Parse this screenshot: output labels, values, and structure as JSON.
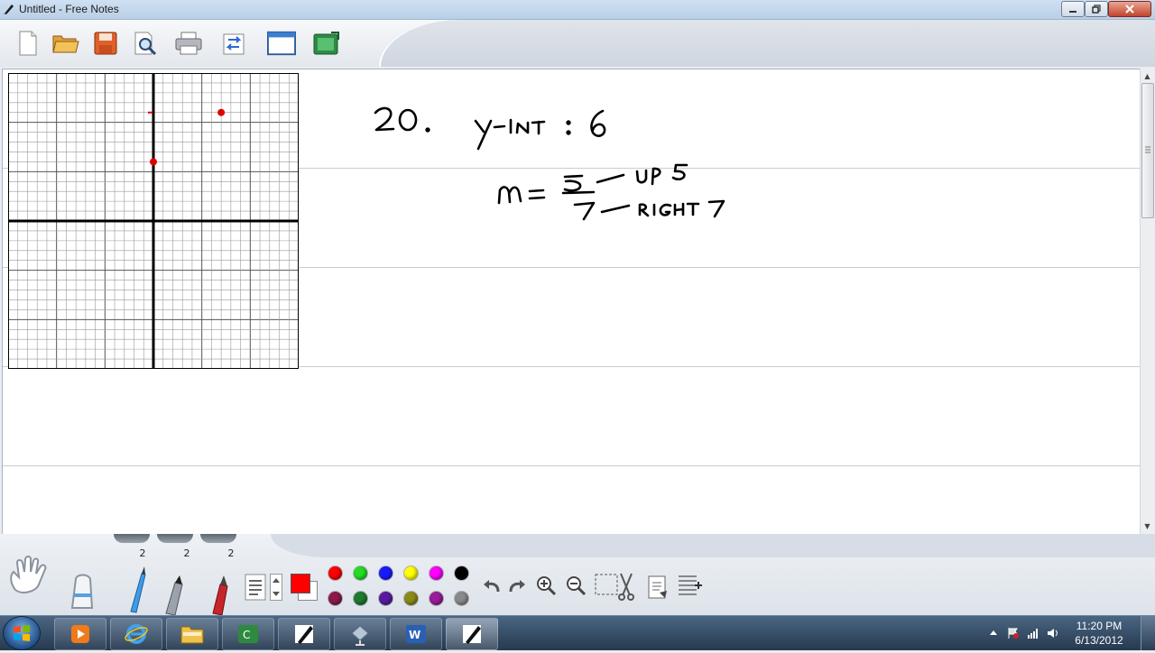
{
  "window": {
    "title": "Untitled - Free Notes"
  },
  "toolbar": {
    "buttons": [
      {
        "name": "new-document-icon"
      },
      {
        "name": "open-folder-icon"
      },
      {
        "name": "save-icon"
      },
      {
        "name": "print-preview-icon"
      },
      {
        "name": "print-icon"
      },
      {
        "name": "import-export-icon"
      },
      {
        "name": "window-view-icon"
      },
      {
        "name": "screen-capture-icon"
      }
    ]
  },
  "notes": {
    "problem_number": "20.",
    "y_intercept_text": "y-int : 6",
    "slope_label": "m=",
    "rise_text": "5 — UP 5",
    "run_text": "7 — RIGHT 7",
    "graph_points": [
      {
        "x": 0,
        "y": 6
      },
      {
        "x": 7,
        "y": 11
      }
    ]
  },
  "pen_widths": [
    "2",
    "2",
    "2"
  ],
  "tools": {
    "selected_color": "#ff0000",
    "palette_row1": [
      "#ff0000",
      "#22dd22",
      "#1a1aff",
      "#ffff00",
      "#ff00ff",
      "#000000"
    ],
    "palette_row2": [
      "#8b1a4a",
      "#1e7a2e",
      "#5a1aa0",
      "#8a8a1a",
      "#9a1a9a",
      "#8a8a8a"
    ],
    "tool_icons": [
      "hand-icon",
      "eraser-icon",
      "pencil-icon",
      "marker-icon",
      "brush-icon",
      "text-lines-icon"
    ],
    "action_icons": [
      "undo-icon",
      "redo-icon",
      "zoom-in-icon",
      "zoom-out-icon",
      "select-cut-icon",
      "paste-icon",
      "insert-page-icon"
    ]
  },
  "taskbar": {
    "clock_time": "11:20 PM",
    "clock_date": "6/13/2012",
    "tasks": [
      "media-player-icon",
      "internet-explorer-icon",
      "file-explorer-icon",
      "camtasia-icon",
      "notes-pen-icon",
      "network-icon",
      "word-icon",
      "free-notes-icon"
    ]
  }
}
